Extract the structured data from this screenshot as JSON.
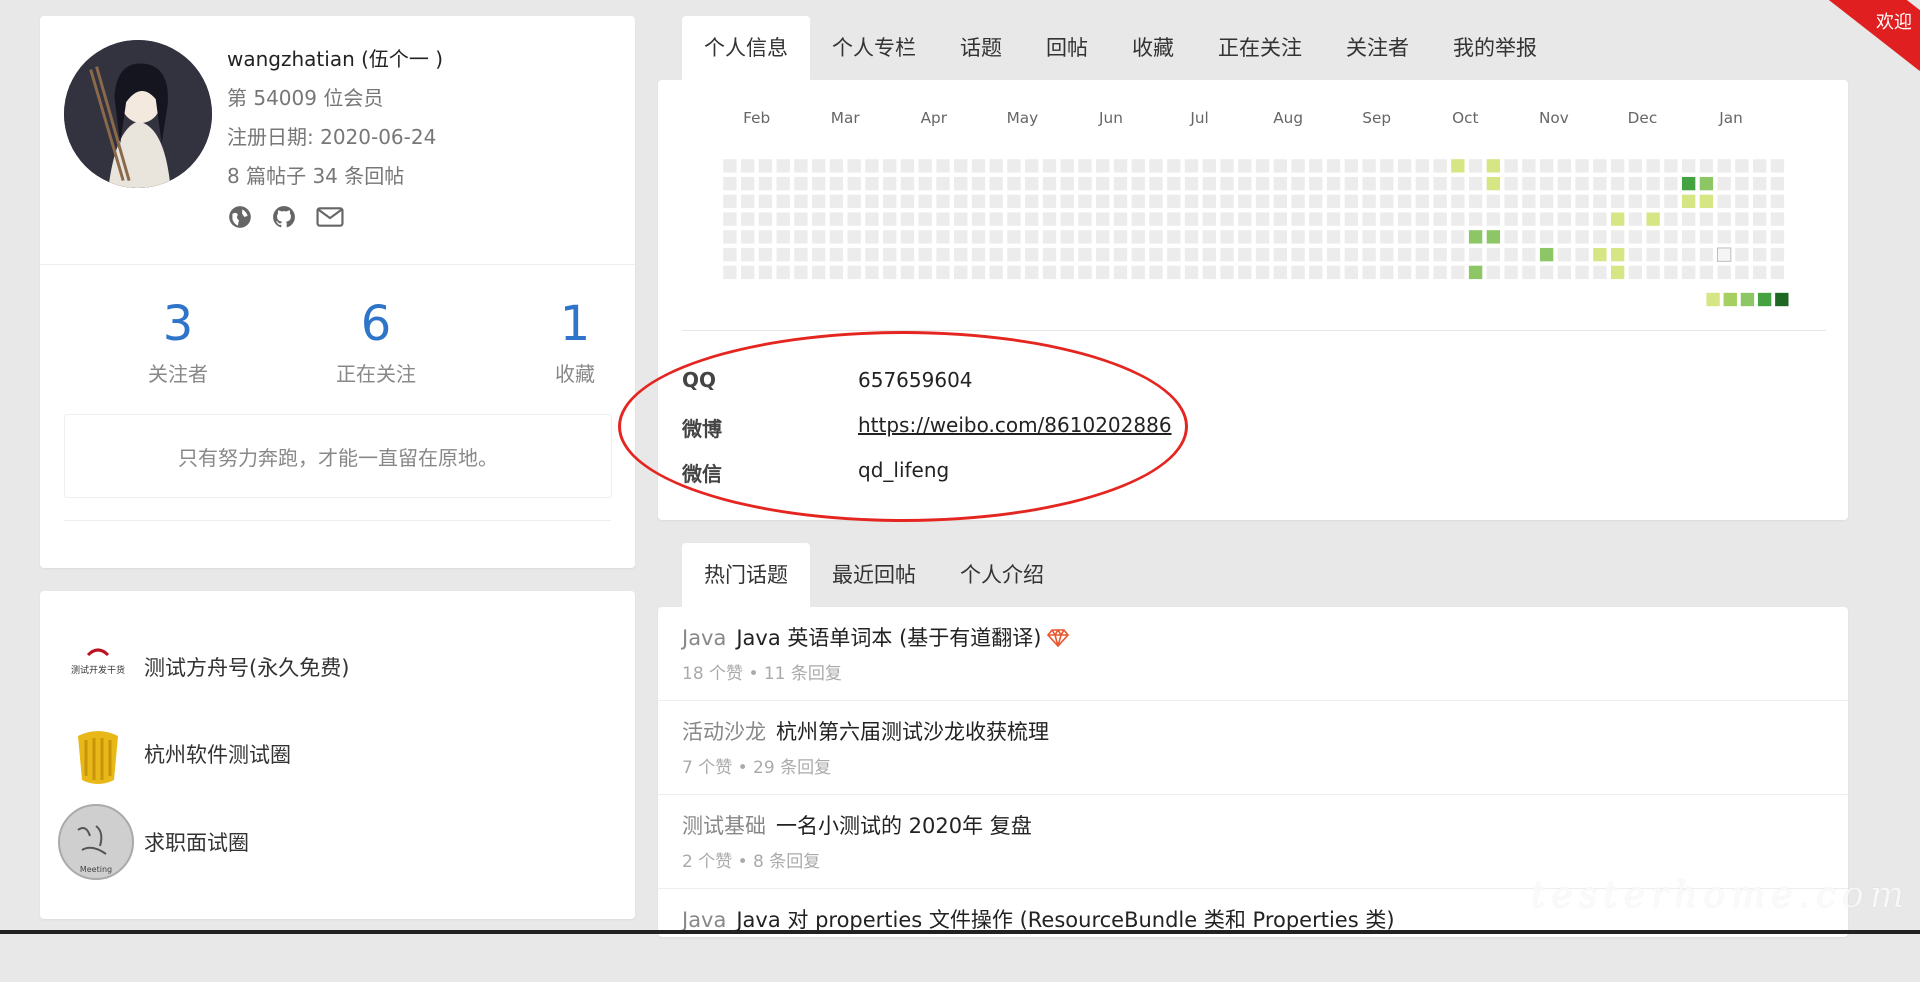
{
  "profile": {
    "name": "wangzhatian (伍个一 )",
    "member_no": "第 54009 位会员",
    "register": "注册日期: 2020-06-24",
    "posts": "8 篇帖子 34 条回帖",
    "icons": [
      "globe-icon",
      "github-icon",
      "mail-icon"
    ]
  },
  "stats": [
    {
      "num": "3",
      "label": "关注者"
    },
    {
      "num": "6",
      "label": "正在关注"
    },
    {
      "num": "1",
      "label": "收藏"
    }
  ],
  "motto": "只有努力奔跑，才能一直留在原地。",
  "teams": [
    {
      "name": "测试方舟号(永久免费)",
      "logo_text": "测试开发干货"
    },
    {
      "name": "杭州软件测试圈",
      "logo_text": ""
    },
    {
      "name": "求职面试圈",
      "logo_text": "Meeting"
    }
  ],
  "profile_tabs": [
    "个人信息",
    "个人专栏",
    "话题",
    "回帖",
    "收藏",
    "正在关注",
    "关注者",
    "我的举报"
  ],
  "heatmap": {
    "months": [
      "Feb",
      "Mar",
      "Apr",
      "May",
      "Jun",
      "Jul",
      "Aug",
      "Sep",
      "Oct",
      "Nov",
      "Dec",
      "Jan"
    ],
    "colors": {
      "empty": "#ececec",
      "l1": "#d6e685",
      "l2": "#8cc665",
      "l3": "#44a340",
      "l4": "#1e6823"
    }
  },
  "contact": {
    "qq_label": "QQ",
    "qq": "657659604",
    "weibo_label": "微博",
    "weibo": "https://weibo.com/8610202886",
    "wechat_label": "微信",
    "wechat": "qd_lifeng"
  },
  "topic_tabs": [
    "热门话题",
    "最近回帖",
    "个人介绍"
  ],
  "topics": [
    {
      "node": "Java",
      "title": "Java 英语单词本 (基于有道翻译)",
      "meta": "18 个赞 • 11 条回复",
      "gem": true
    },
    {
      "node": "活动沙龙",
      "title": "杭州第六届测试沙龙收获梳理",
      "meta": "7 个赞 • 29 条回复",
      "gem": false
    },
    {
      "node": "测试基础",
      "title": "一名小测试的 2020年 复盘",
      "meta": "2 个赞 • 8 条回复",
      "gem": false
    },
    {
      "node": "Java",
      "title": "Java 对 properties 文件操作 (ResourceBundle 类和 Properties 类)",
      "meta": "",
      "gem": false
    }
  ],
  "welcome": "欢迎",
  "watermark": "testerhome.com"
}
